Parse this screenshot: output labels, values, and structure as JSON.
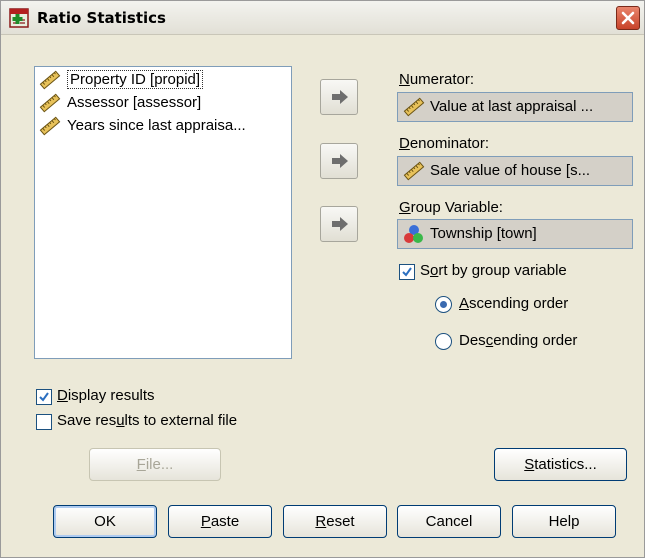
{
  "window": {
    "title": "Ratio Statistics"
  },
  "variables": [
    {
      "label": "Property ID [propid]",
      "icon": "ruler-icon",
      "selected": true
    },
    {
      "label": "Assessor [assessor]",
      "icon": "ruler-icon"
    },
    {
      "label": "Years since last appraisa...",
      "icon": "ruler-icon"
    }
  ],
  "numerator": {
    "label_u": "N",
    "label_rest": "umerator:",
    "value": "Value at last appraisal ...",
    "icon": "ruler-icon"
  },
  "denominator": {
    "label_u": "D",
    "label_rest": "enominator:",
    "value": "Sale value of house [s...",
    "icon": "ruler-icon"
  },
  "group": {
    "label_u": "G",
    "label_rest": "roup Variable:",
    "value": "Township [town]",
    "icon": "nominal-icon"
  },
  "sort_by_group": {
    "label_pre": "S",
    "label_u": "o",
    "label_rest": "rt by group variable",
    "checked": true
  },
  "ascending": {
    "label_u": "A",
    "label_rest": "scending order",
    "selected": true
  },
  "descending": {
    "label_pre": "Des",
    "label_u": "c",
    "label_rest": "ending order",
    "selected": false
  },
  "display_results": {
    "label_u": "D",
    "label_rest": "isplay results",
    "checked": true
  },
  "save_results": {
    "label_pre": "Save res",
    "label_u": "u",
    "label_rest": "lts to external file",
    "checked": false
  },
  "buttons": {
    "file": {
      "label_u": "F",
      "label_rest": "ile...",
      "enabled": false
    },
    "statistics": {
      "label_u": "S",
      "label_rest": "tatistics..."
    },
    "ok": {
      "label": "OK"
    },
    "paste": {
      "label_u": "P",
      "label_rest": "aste"
    },
    "reset": {
      "label_u": "R",
      "label_rest": "eset"
    },
    "cancel": {
      "label": "Cancel"
    },
    "help": {
      "label": "Help"
    }
  },
  "colors": {
    "dialog_bg": "#ece9d8",
    "field_bg": "#d4d0c8",
    "close_red": "#c8432a"
  }
}
